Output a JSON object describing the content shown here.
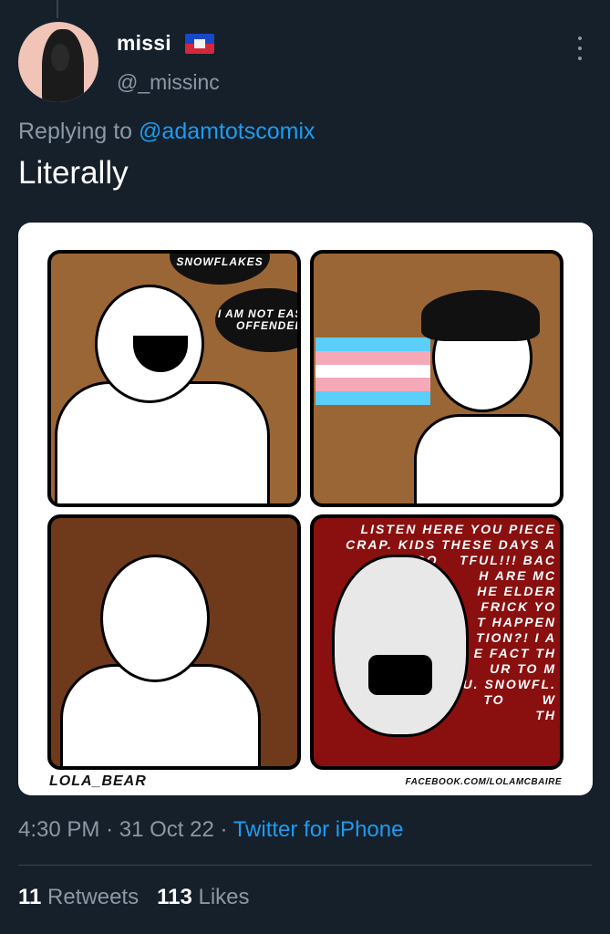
{
  "user": {
    "display_name": "missi",
    "handle": "@_missinc",
    "flag_icon": "haiti-flag-icon"
  },
  "reply": {
    "prefix": "Replying to",
    "mention": "@adamtotscomix"
  },
  "tweet": {
    "text": "Literally"
  },
  "comic": {
    "panel1_bubble1": "UNLIKE YOU SNOWFLAKES",
    "panel1_bubble2": "I AM NOT EASILY OFFENDED",
    "panel4_text": "LISTEN HERE YOU PIECE\nCRAP. KIDS THESE DAYS A\nSO    TFUL!!! BAC\nN       H ARE MC\nRES      HE ELDER\nHO       FRICK YO\nOH      T HAPPEN\nT       TION?! I A\n      E FACT TH\n       UR TO M\n    U. SNOWFL.\n        TO       W\n              TH",
    "signature": "LOLA_BEAR",
    "credit": "FACEBOOK.COM/LOLAMCBAIRE"
  },
  "meta": {
    "time": "4:30 PM",
    "date": "31 Oct 22",
    "source": "Twitter for iPhone"
  },
  "stats": {
    "retweets_count": "11",
    "retweets_label": "Retweets",
    "likes_count": "113",
    "likes_label": "Likes"
  },
  "colors": {
    "background": "#15202b",
    "accent": "#1d9bf0",
    "secondary_text": "#8b98a5",
    "trans_blue": "#5bcefa",
    "trans_pink": "#f5a9b8"
  }
}
